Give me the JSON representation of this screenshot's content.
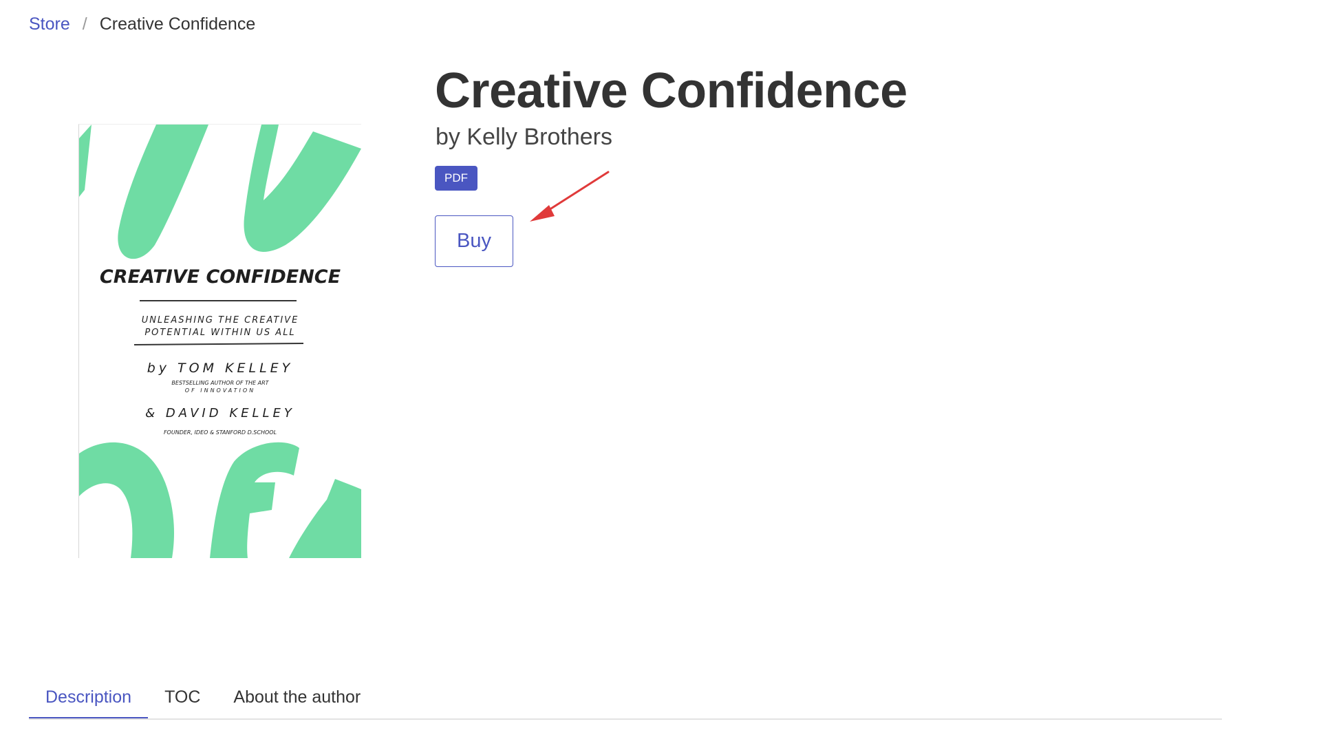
{
  "breadcrumb": {
    "store_label": "Store",
    "separator": "/",
    "current_label": "Creative Confidence"
  },
  "book": {
    "title": "Creative Confidence",
    "author_line": "by Kelly Brothers",
    "format_badge": "PDF",
    "buy_label": "Buy"
  },
  "cover": {
    "title": "CREATIVE CONFIDENCE",
    "subtitle_line1": "UNLEASHING THE CREATIVE",
    "subtitle_line2": "POTENTIAL WITHIN US ALL",
    "author1": "by TOM KELLEY",
    "author1_note_line1": "BESTSELLING AUTHOR OF THE ART",
    "author1_note_line2": "OF INNOVATION",
    "author2": "& DAVID KELLEY",
    "author2_note": "FOUNDER, IDEO & STANFORD D.SCHOOL"
  },
  "tabs": [
    {
      "label": "Description",
      "active": true
    },
    {
      "label": "TOC",
      "active": false
    },
    {
      "label": "About the author",
      "active": false
    }
  ],
  "colors": {
    "accent": "#4a56c1",
    "cover_green": "#6fdca4",
    "annotation_arrow": "#e03a3a",
    "text": "#333333"
  }
}
